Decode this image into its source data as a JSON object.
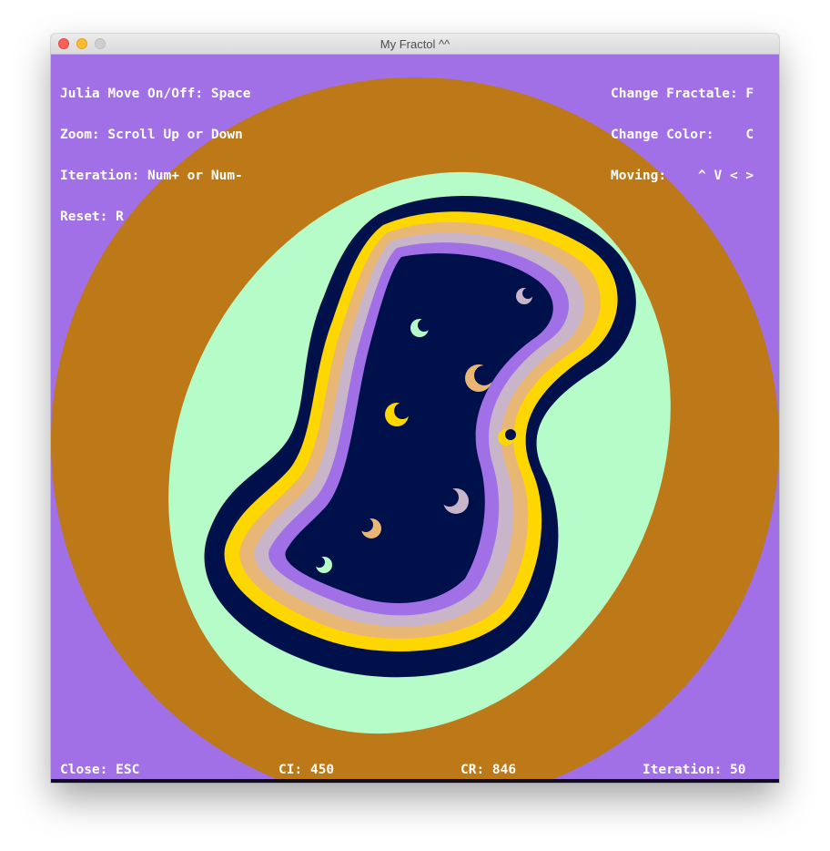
{
  "window": {
    "title": "My Fractol ^^"
  },
  "hud": {
    "left_lines": [
      "Julia Move On/Off: Space",
      "Zoom: Scroll Up or Down",
      "Iteration: Num+ or Num-",
      "Reset: R"
    ],
    "right_lines": [
      "Change Fractale: F",
      "Change Color:    C",
      "Moving:    ^ V < >"
    ]
  },
  "status": {
    "close": "Close: ESC",
    "ci": "CI: 450",
    "cr": "CR: 846",
    "iteration": "Iteration: 50"
  },
  "palette": {
    "background": "#a170e6",
    "ring_outer": "#bd7817",
    "ring_mint": "#b6fcc8",
    "set_navy": "#00104a",
    "band_yellow": "#ffd700",
    "band_tan": "#e8b776",
    "band_gray": "#c9b5c9",
    "band_purple": "#a170e6"
  }
}
